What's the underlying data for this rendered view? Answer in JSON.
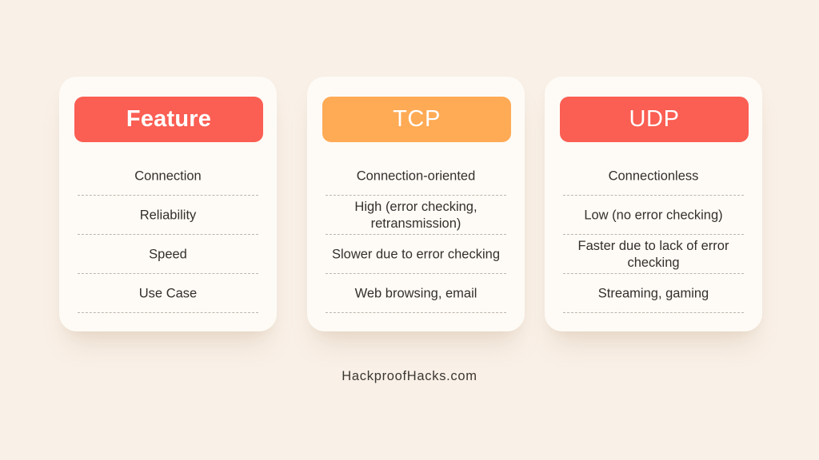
{
  "page": {
    "background_color": "#F9F0E7",
    "card_background_color": "#FEFBF6",
    "text_color": "#332F2C",
    "divider_color": "#BDB5AC"
  },
  "columns": [
    {
      "header": "Feature",
      "header_color": "#FB5E53",
      "header_bold": true,
      "rows": [
        "Connection",
        "Reliability",
        "Speed",
        "Use Case"
      ]
    },
    {
      "header": "TCP",
      "header_color": "#FFAA55",
      "header_bold": false,
      "rows": [
        "Connection-oriented",
        "High (error checking,\nretransmission)",
        "Slower due to error checking",
        "Web browsing, email"
      ]
    },
    {
      "header": "UDP",
      "header_color": "#FB5E53",
      "header_bold": false,
      "rows": [
        "Connectionless",
        "Low (no error checking)",
        "Faster due to lack of error\nchecking",
        "Streaming, gaming"
      ]
    }
  ],
  "footer": {
    "text": "HackproofHacks.com"
  }
}
